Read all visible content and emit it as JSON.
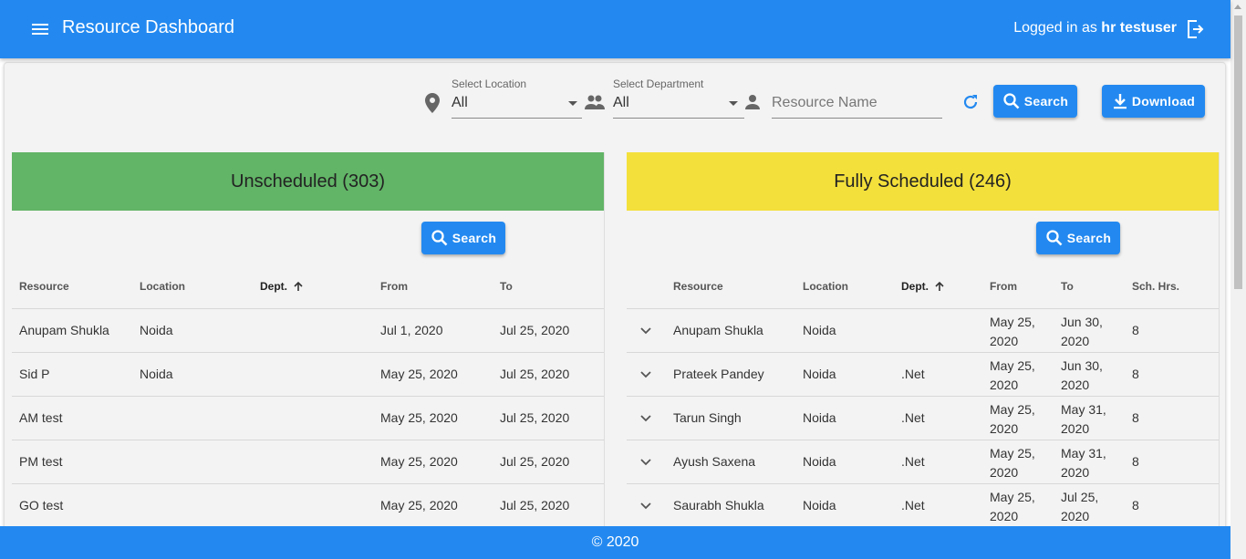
{
  "app": {
    "title": "Resource Dashboard",
    "login_prefix": "Logged in as ",
    "username": "hr testuser"
  },
  "filters": {
    "location_label": "Select Location",
    "location_value": "All",
    "department_label": "Select Department",
    "department_value": "All",
    "resource_placeholder": "Resource Name",
    "search_label": "Search",
    "download_label": "Download"
  },
  "unscheduled": {
    "title": "Unscheduled (303)",
    "search_label": "Search",
    "columns": [
      "Resource",
      "Location",
      "Dept.",
      "From",
      "To"
    ],
    "rows": [
      {
        "resource": "Anupam Shukla",
        "location": "Noida",
        "dept": "",
        "from": "Jul 1, 2020",
        "to": "Jul 25, 2020"
      },
      {
        "resource": "Sid P",
        "location": "Noida",
        "dept": "",
        "from": "May 25, 2020",
        "to": "Jul 25, 2020"
      },
      {
        "resource": "AM test",
        "location": "",
        "dept": "",
        "from": "May 25, 2020",
        "to": "Jul 25, 2020"
      },
      {
        "resource": "PM test",
        "location": "",
        "dept": "",
        "from": "May 25, 2020",
        "to": "Jul 25, 2020"
      },
      {
        "resource": "GO test",
        "location": "",
        "dept": "",
        "from": "May 25, 2020",
        "to": "Jul 25, 2020"
      }
    ]
  },
  "fully_scheduled": {
    "title": "Fully Scheduled (246)",
    "search_label": "Search",
    "columns": [
      "Resource",
      "Location",
      "Dept.",
      "From",
      "To",
      "Sch. Hrs."
    ],
    "rows": [
      {
        "resource": "Anupam Shukla",
        "location": "Noida",
        "dept": "",
        "from": "May 25, 2020",
        "to": "Jun 30, 2020",
        "hrs": "8"
      },
      {
        "resource": "Prateek Pandey",
        "location": "Noida",
        "dept": ".Net",
        "from": "May 25, 2020",
        "to": "Jun 30, 2020",
        "hrs": "8"
      },
      {
        "resource": "Tarun Singh",
        "location": "Noida",
        "dept": ".Net",
        "from": "May 25, 2020",
        "to": "May 31, 2020",
        "hrs": "8"
      },
      {
        "resource": "Ayush Saxena",
        "location": "Noida",
        "dept": ".Net",
        "from": "May 25, 2020",
        "to": "May 31, 2020",
        "hrs": "8"
      },
      {
        "resource": "Saurabh Shukla",
        "location": "Noida",
        "dept": ".Net",
        "from": "May 25, 2020",
        "to": "Jul 25, 2020",
        "hrs": "8"
      }
    ]
  },
  "footer": {
    "text": "© 2020"
  },
  "colors": {
    "primary": "#2389f0",
    "unscheduled": "#62b467",
    "fully_scheduled": "#f3e03b"
  }
}
